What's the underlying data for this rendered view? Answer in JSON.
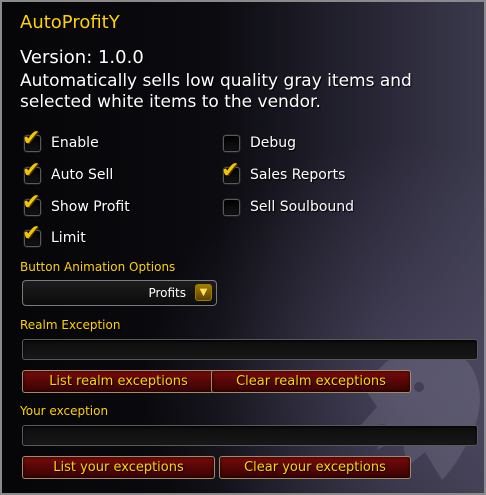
{
  "app": {
    "title": "AutoProfitY",
    "version": "Version: 1.0.0",
    "description": "Automatically sells low quality gray items and selected white items to the vendor."
  },
  "options": {
    "enable": {
      "label": "Enable",
      "checked": true
    },
    "debug": {
      "label": "Debug",
      "checked": false
    },
    "auto_sell": {
      "label": "Auto Sell",
      "checked": true
    },
    "sales_reports": {
      "label": "Sales Reports",
      "checked": true
    },
    "show_profit": {
      "label": "Show Profit",
      "checked": true
    },
    "sell_soulbound": {
      "label": "Sell Soulbound",
      "checked": false
    },
    "limit": {
      "label": "Limit",
      "checked": true
    }
  },
  "animation": {
    "label": "Button Animation Options",
    "selected": "Profits"
  },
  "realm": {
    "label": "Realm Exception",
    "value": "",
    "list_button": "List realm exceptions",
    "clear_button": "Clear realm exceptions"
  },
  "personal": {
    "label": "Your exception",
    "value": "",
    "list_button": "List your exceptions",
    "clear_button": "Clear your exceptions"
  },
  "colors": {
    "title": "#ffd200",
    "button_bg": "#5a0707",
    "check": "#f2c500"
  }
}
